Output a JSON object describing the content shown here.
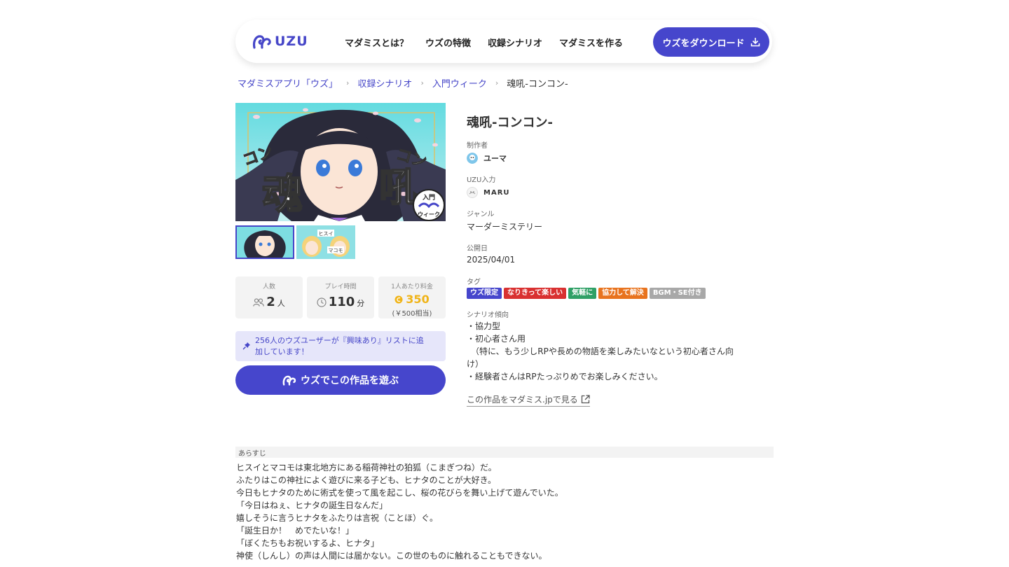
{
  "header": {
    "logo_text": "UZU",
    "nav": [
      "マダミスとは？",
      "ウズの特徴",
      "収録シナリオ",
      "マダミスを作る"
    ],
    "download_label": "ウズをダウンロード"
  },
  "breadcrumb": {
    "items": [
      "マダミスアプリ「ウズ」",
      "収録シナリオ",
      "入門ウィーク"
    ],
    "current": "魂吼-コンコン-"
  },
  "cover": {
    "left_text": "魂",
    "right_text": "吼",
    "top_left": "コン",
    "top_right": "コン",
    "badge_top": "入門",
    "badge_bottom": "ウィーク",
    "thumb2_labels": [
      "ヒスイ",
      "マコモ"
    ]
  },
  "stats": {
    "players_label": "人数",
    "players_value": "2",
    "players_unit": "人",
    "time_label": "プレイ時間",
    "time_value": "110",
    "time_unit": "分",
    "price_label": "1人あたり料金",
    "price_value": "350",
    "price_sub": "(￥500相当)"
  },
  "interest": {
    "line1": "256人のウズユーザーが『興味あり』リストに追",
    "line2": "加しています！"
  },
  "play_button": "ウズでこの作品を遊ぶ",
  "info": {
    "title": "魂吼-コンコン-",
    "creator_label": "制作者",
    "creator_name": "ユーマ",
    "input_label": "UZU入力",
    "input_name": "MARU",
    "genre_label": "ジャンル",
    "genre_value": "マーダーミステリー",
    "date_label": "公開日",
    "date_value": "2025/04/01",
    "tags_label": "タグ",
    "tags": [
      {
        "text": "ウズ限定",
        "color": "#4646cc"
      },
      {
        "text": "なりきって楽しい",
        "color": "#d93030"
      },
      {
        "text": "気軽に",
        "color": "#2fa066"
      },
      {
        "text": "協力して解決",
        "color": "#e8731e"
      },
      {
        "text": "BGM・SE付き",
        "color": "#a8a8a8"
      }
    ],
    "tendency_label": "シナリオ傾向",
    "tendency_lines": [
      "・協力型",
      "・初心者さん用",
      "　（特に、もう少しRPや長めの物語を楽しみたいなという初心者さん向",
      "け）",
      "・経験者さんはRPたっぷりめでお楽しみください。"
    ],
    "external_link": "この作品をマダミス.jpで見る"
  },
  "synopsis": {
    "label": "あらすじ",
    "lines": [
      "ヒスイとマコモは東北地方にある稲荷神社の狛狐（こまぎつね）だ。",
      "ふたりはこの神社によく遊びに来る子ども、ヒナタのことが大好き。",
      "今日もヒナタのために術式を使って風を起こし、桜の花びらを舞い上げて遊んでいた。",
      "「今日はねぇ、ヒナタの誕生日なんだ」",
      "嬉しそうに言うヒナタをふたりは言祝（ことほ）ぐ。",
      "「誕生日か！　めでたいな！」",
      "「ぼくたちもお祝いするよ、ヒナタ」",
      "神使（しんし）の声は人間には届かない。この世のものに触れることもできない。"
    ]
  }
}
